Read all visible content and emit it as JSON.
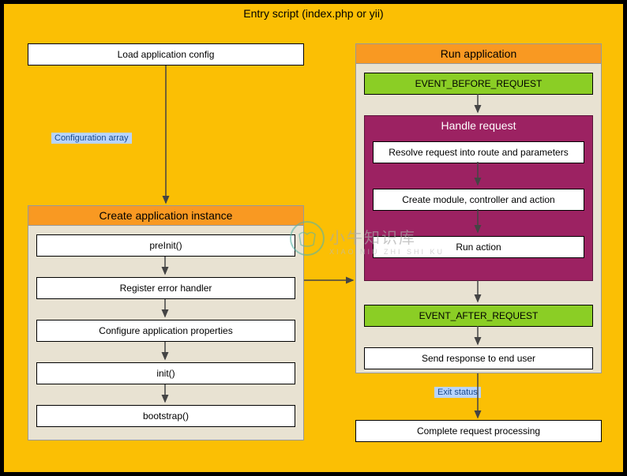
{
  "diagram": {
    "title": "Entry script (index.php or yii)",
    "boxes": {
      "loadConfig": "Load application config",
      "completeProcessing": "Complete request processing"
    },
    "labels": {
      "configArray": "Configuration array",
      "exitStatus": "Exit status"
    },
    "createPanel": {
      "title": "Create application instance",
      "steps": [
        "preInit()",
        "Register error handler",
        "Configure application properties",
        "init()",
        "bootstrap()"
      ]
    },
    "runPanel": {
      "title": "Run application",
      "eventBefore": "EVENT_BEFORE_REQUEST",
      "eventAfter": "EVENT_AFTER_REQUEST",
      "sendResponse": "Send response to end user",
      "handle": {
        "title": "Handle request",
        "steps": [
          "Resolve request into route and parameters",
          "Create module, controller and action",
          "Run action"
        ]
      }
    }
  },
  "watermark": {
    "cn": "小牛知识库",
    "en": "XIAO NIU ZHI SHI KU"
  }
}
